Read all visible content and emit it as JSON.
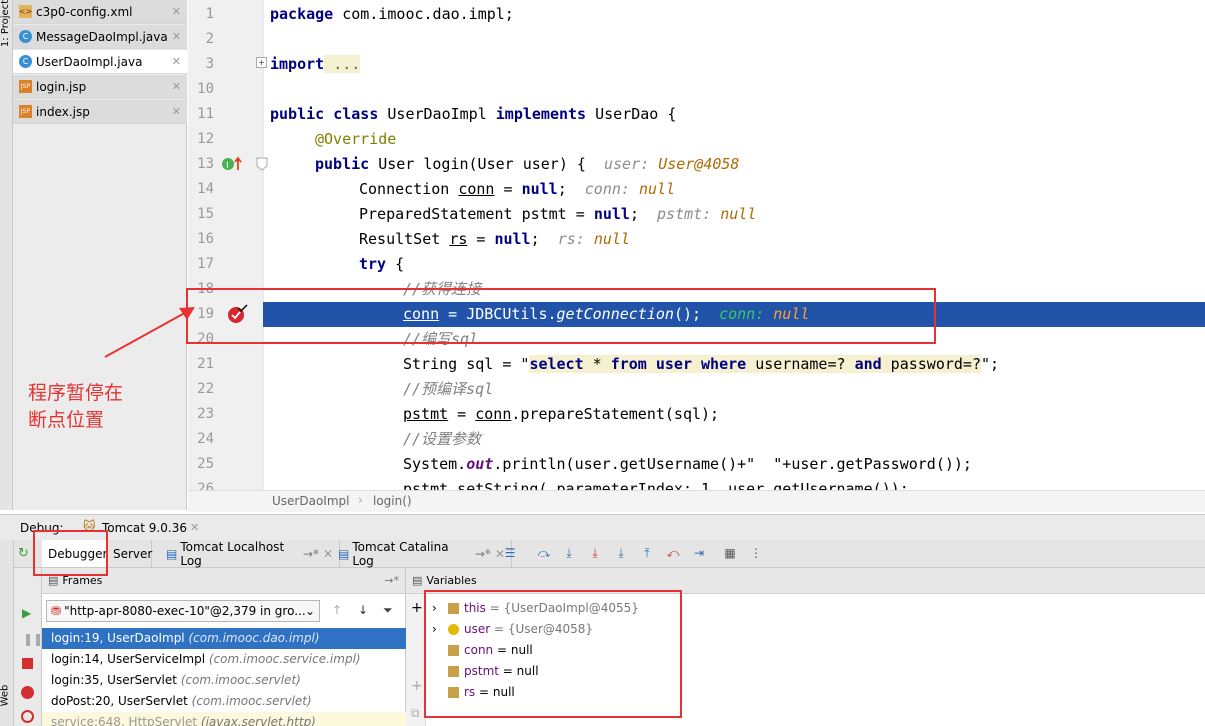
{
  "sidebar": {
    "project_label": "1: Project",
    "web_label": "Web"
  },
  "file_tabs": [
    {
      "name": "c3p0-config.xml",
      "icon": "xml-icon",
      "active": false
    },
    {
      "name": "MessageDaoImpl.java",
      "icon": "class-icon",
      "active": false
    },
    {
      "name": "UserDaoImpl.java",
      "icon": "class-icon",
      "active": true
    },
    {
      "name": "login.jsp",
      "icon": "jsp-icon",
      "active": false
    },
    {
      "name": "index.jsp",
      "icon": "jsp-icon",
      "active": false
    }
  ],
  "line_numbers": [
    "1",
    "2",
    "3",
    "10",
    "11",
    "12",
    "13",
    "14",
    "15",
    "16",
    "17",
    "18",
    "19",
    "20",
    "21",
    "22",
    "23",
    "24",
    "25",
    "26"
  ],
  "code": {
    "l1": {
      "kw": "package",
      "rest": " com.imooc.dao.impl;"
    },
    "l3": {
      "kw": "import",
      "rest": " ..."
    },
    "l11": {
      "kw1": "public class",
      "mid": " UserDaoImpl ",
      "kw2": "implements",
      "rest": " UserDao {"
    },
    "l12": {
      "text": "@Override"
    },
    "l13": {
      "kw": "public",
      "rest": " User login(User user) {",
      "hint_name": "user:",
      "hint_val": "User@4058"
    },
    "l14": {
      "type": "Connection ",
      "var": "conn",
      "eq": " = ",
      "kw": "null",
      "end": ";",
      "hint_name": "conn:",
      "hint_val": "null"
    },
    "l15": {
      "type": "PreparedStatement ",
      "var": "pstmt",
      "eq": " = ",
      "kw": "null",
      "end": ";",
      "hint_name": "pstmt:",
      "hint_val": "null"
    },
    "l16": {
      "type": "ResultSet ",
      "var": "rs",
      "eq": " = ",
      "kw": "null",
      "end": ";",
      "hint_name": "rs:",
      "hint_val": "null"
    },
    "l17": {
      "kw": "try",
      "rest": " {"
    },
    "l18": {
      "text": "//获得连接"
    },
    "l19": {
      "var": "conn",
      "mid": " = JDBCUtils.",
      "fn": "getConnection",
      "end": "();",
      "hint_name": "conn:",
      "hint_val": "null"
    },
    "l20": {
      "text": "//编写sql"
    },
    "l21": {
      "pre": "String sql = \"",
      "k1": "select",
      "s1": " * ",
      "k2": "from",
      "s2": " ",
      "k3": "user",
      "s3": " ",
      "k4": "where",
      "s4": " username=? ",
      "k5": "and",
      "s5": " password=?",
      "end": "\";"
    },
    "l22": {
      "text": "//预编译sql"
    },
    "l23": {
      "var": "pstmt",
      "mid": " = ",
      "var2": "conn",
      "end": ".prepareStatement(sql);"
    },
    "l24": {
      "text": "//设置参数"
    },
    "l25": {
      "pre": "System.",
      "field": "out",
      "rest": ".println(user.getUsername()+\"  \"+user.getPassword());"
    },
    "l26": {
      "text": "pstmt.setString( parameterIndex: 1, user.getUsername());"
    }
  },
  "breadcrumb": {
    "class": "UserDaoImpl",
    "method": "login()"
  },
  "annotation": {
    "line1": "程序暂停在",
    "line2": "断点位置"
  },
  "debug": {
    "label": "Debug:",
    "session": "Tomcat 9.0.36",
    "tabs": [
      "Debugger",
      "Server",
      "Tomcat Localhost Log",
      "Tomcat Catalina Log"
    ],
    "frames_title": "Frames",
    "variables_title": "Variables",
    "thread": "\"http-apr-8080-exec-10\"@2,379 in gro...",
    "frames": [
      {
        "loc": "login:19, UserDaoImpl",
        "pkg": "(com.imooc.dao.impl)",
        "selected": true
      },
      {
        "loc": "login:14, UserServiceImpl",
        "pkg": "(com.imooc.service.impl)",
        "selected": false
      },
      {
        "loc": "login:35, UserServlet",
        "pkg": "(com.imooc.servlet)",
        "selected": false
      },
      {
        "loc": "doPost:20, UserServlet",
        "pkg": "(com.imooc.servlet)",
        "selected": false
      },
      {
        "loc": "service:648, HttpServlet",
        "pkg": "(javax.servlet.http)",
        "selected": false
      }
    ],
    "variables": [
      {
        "name": "this",
        "value": "= {UserDaoImpl@4055}",
        "expandable": true
      },
      {
        "name": "user",
        "value": "= {User@4058}",
        "expandable": true
      },
      {
        "name": "conn",
        "value": "= null",
        "expandable": false
      },
      {
        "name": "pstmt",
        "value": "= null",
        "expandable": false
      },
      {
        "name": "rs",
        "value": "= null",
        "expandable": false
      }
    ]
  },
  "colors": {
    "exec_line": "#2154a8",
    "annotation": "#e53333",
    "keyword": "#000080",
    "frame_selected": "#2f72c4"
  }
}
